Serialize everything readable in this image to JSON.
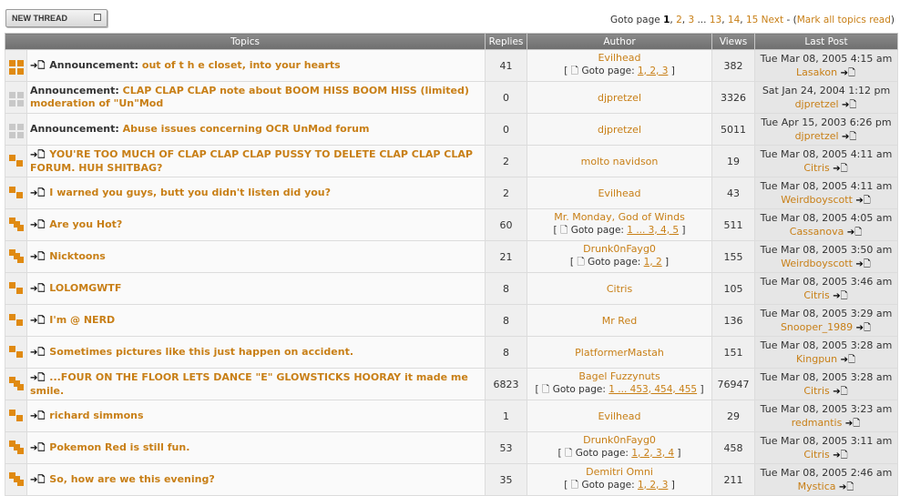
{
  "toolbar": {
    "new_thread": "NEW THREAD"
  },
  "pagination": {
    "goto": "Goto page ",
    "current": "1",
    "pages": [
      ", ",
      "2",
      ", ",
      "3",
      " ... ",
      "13",
      ", ",
      "14",
      ", ",
      "15",
      "  ",
      "Next"
    ],
    "sep": " - (",
    "mark_all": "Mark all topics read",
    "close": ")"
  },
  "columns": {
    "topics": "Topics",
    "replies": "Replies",
    "author": "Author",
    "views": "Views",
    "last_post": "Last Post"
  },
  "goto_label": "Goto page:",
  "rows": [
    {
      "icon": "grid",
      "prefix": "Announcement: ",
      "title": "out of t h e closet, into your hearts",
      "arrow": true,
      "replies": "41",
      "author": "Evilhead",
      "goto": "1, 2, 3",
      "views": "382",
      "date": "Tue Mar 08, 2005 4:15 am",
      "poster": "Lasakon"
    },
    {
      "icon": "gray",
      "prefix": "Announcement: ",
      "title": "CLAP CLAP CLAP note about BOOM HISS BOOM HISS (limited) moderation of \"Un\"Mod",
      "arrow": false,
      "replies": "0",
      "author": "djpretzel",
      "goto": "",
      "views": "3326",
      "date": "Sat Jan 24, 2004 1:12 pm",
      "poster": "djpretzel"
    },
    {
      "icon": "gray",
      "prefix": "Announcement: ",
      "title": "Abuse issues concerning OCR UnMod forum",
      "arrow": false,
      "replies": "0",
      "author": "djpretzel",
      "goto": "",
      "views": "5011",
      "date": "Tue Apr 15, 2003 6:26 pm",
      "poster": "djpretzel"
    },
    {
      "icon": "stair",
      "prefix": "",
      "title": "YOU'RE TOO MUCH OF CLAP CLAP CLAP PUSSY TO DELETE CLAP CLAP CLAP FORUM. HUH SHITBAG?",
      "arrow": true,
      "replies": "2",
      "author": "molto navidson",
      "goto": "",
      "views": "19",
      "date": "Tue Mar 08, 2005 4:11 am",
      "poster": "Citris"
    },
    {
      "icon": "stair",
      "prefix": "",
      "title": "I warned you guys, butt you didn't listen did you?",
      "arrow": true,
      "replies": "2",
      "author": "Evilhead",
      "goto": "",
      "views": "43",
      "date": "Tue Mar 08, 2005 4:11 am",
      "poster": "Weirdboyscott"
    },
    {
      "icon": "stair2",
      "prefix": "",
      "title": "Are you Hot?",
      "arrow": true,
      "replies": "60",
      "author": "Mr. Monday, God of Winds",
      "goto": "1 ... 3, 4, 5",
      "views": "511",
      "date": "Tue Mar 08, 2005 4:05 am",
      "poster": "Cassanova"
    },
    {
      "icon": "stair2",
      "prefix": "",
      "title": "Nicktoons",
      "arrow": true,
      "replies": "21",
      "author": "Drunk0nFayg0",
      "goto": "1, 2",
      "views": "155",
      "date": "Tue Mar 08, 2005 3:50 am",
      "poster": "Weirdboyscott"
    },
    {
      "icon": "stair",
      "prefix": "",
      "title": "LOLOMGWTF",
      "arrow": true,
      "replies": "8",
      "author": "Citris",
      "goto": "",
      "views": "105",
      "date": "Tue Mar 08, 2005 3:46 am",
      "poster": "Citris"
    },
    {
      "icon": "stair",
      "prefix": "",
      "title": "I'm @ NERD",
      "arrow": true,
      "replies": "8",
      "author": "Mr Red",
      "goto": "",
      "views": "136",
      "date": "Tue Mar 08, 2005 3:29 am",
      "poster": "Snooper_1989"
    },
    {
      "icon": "stair",
      "prefix": "",
      "title": "Sometimes pictures like this just happen on accident.",
      "arrow": true,
      "replies": "8",
      "author": "PlatformerMastah",
      "goto": "",
      "views": "151",
      "date": "Tue Mar 08, 2005 3:28 am",
      "poster": "Kingpun"
    },
    {
      "icon": "stair2",
      "prefix": "",
      "title": "...FOUR ON THE FLOOR LETS DANCE \"E\" GLOWSTICKS HOORAY it made me smile.",
      "arrow": true,
      "replies": "6823",
      "author": "Bagel Fuzzynuts",
      "goto": "1 ... 453, 454, 455",
      "views": "76947",
      "date": "Tue Mar 08, 2005 3:28 am",
      "poster": "Citris"
    },
    {
      "icon": "stair",
      "prefix": "",
      "title": "richard simmons",
      "arrow": true,
      "replies": "1",
      "author": "Evilhead",
      "goto": "",
      "views": "29",
      "date": "Tue Mar 08, 2005 3:23 am",
      "poster": "redmantis"
    },
    {
      "icon": "stair2",
      "prefix": "",
      "title": "Pokemon Red is still fun.",
      "arrow": true,
      "replies": "53",
      "author": "Drunk0nFayg0",
      "goto": "1, 2, 3, 4",
      "views": "458",
      "date": "Tue Mar 08, 2005 3:11 am",
      "poster": "Citris"
    },
    {
      "icon": "stair2",
      "prefix": "",
      "title": "So, how are we this evening?",
      "arrow": true,
      "replies": "35",
      "author": "Demitri Omni",
      "goto": "1, 2, 3",
      "views": "211",
      "date": "Tue Mar 08, 2005 2:46 am",
      "poster": "Mystica"
    }
  ]
}
